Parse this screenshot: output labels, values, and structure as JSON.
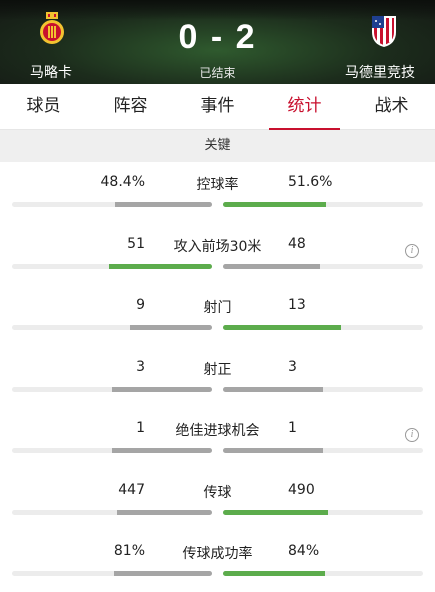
{
  "match": {
    "home_team": "马略卡",
    "away_team": "马德里竞技",
    "home_score": "0",
    "separator": "-",
    "away_score": "2",
    "status": "已结束"
  },
  "tabs": [
    {
      "label": "球员",
      "active": false
    },
    {
      "label": "阵容",
      "active": false
    },
    {
      "label": "事件",
      "active": false
    },
    {
      "label": "统计",
      "active": true
    },
    {
      "label": "战术",
      "active": false
    }
  ],
  "section_title": "关键",
  "colors": {
    "green": "#5cac4c",
    "gray": "#a5a5a5",
    "accent": "#c8102e",
    "track": "#ececec"
  },
  "stats": [
    {
      "label": "控球率",
      "home": "48.4%",
      "away": "51.6%",
      "home_frac": 0.484,
      "away_frac": 0.516,
      "leader": "away",
      "info": false
    },
    {
      "label": "攻入前场30米",
      "home": "51",
      "away": "48",
      "home_frac": 0.515,
      "away_frac": 0.485,
      "leader": "home",
      "info": true
    },
    {
      "label": "射门",
      "home": "9",
      "away": "13",
      "home_frac": 0.409,
      "away_frac": 0.591,
      "leader": "away",
      "info": false
    },
    {
      "label": "射正",
      "home": "3",
      "away": "3",
      "home_frac": 0.5,
      "away_frac": 0.5,
      "leader": "none",
      "info": false
    },
    {
      "label": "绝佳进球机会",
      "home": "1",
      "away": "1",
      "home_frac": 0.5,
      "away_frac": 0.5,
      "leader": "none",
      "info": true
    },
    {
      "label": "传球",
      "home": "447",
      "away": "490",
      "home_frac": 0.477,
      "away_frac": 0.523,
      "leader": "away",
      "info": false
    },
    {
      "label": "传球成功率",
      "home": "81%",
      "away": "84%",
      "home_frac": 0.491,
      "away_frac": 0.509,
      "leader": "away",
      "info": false
    }
  ],
  "icons": {
    "home_crest": "mallorca-crest-icon",
    "away_crest": "atletico-crest-icon",
    "info": "info-icon"
  }
}
